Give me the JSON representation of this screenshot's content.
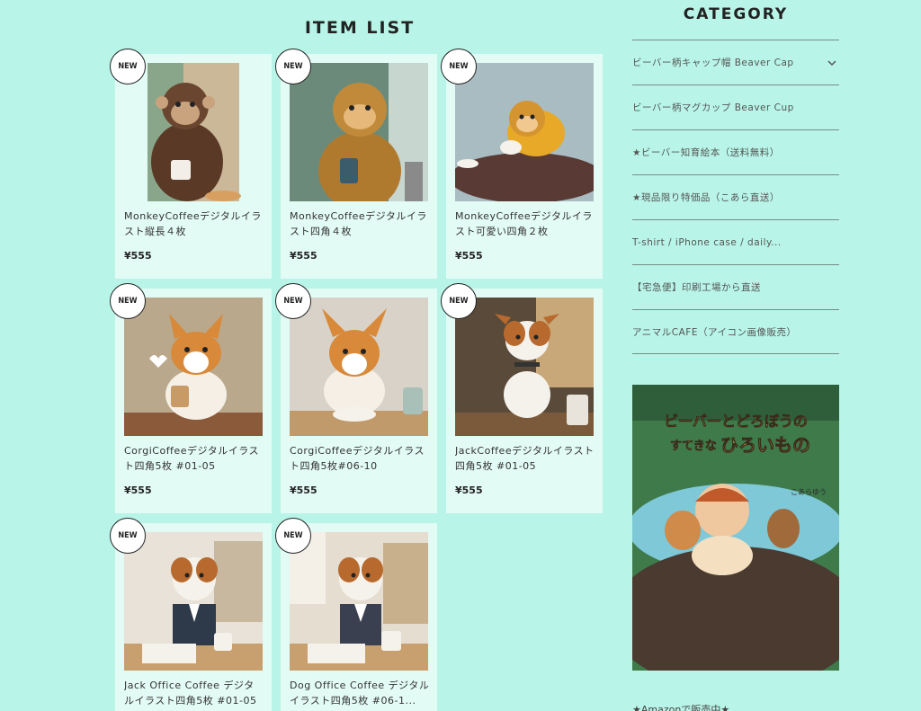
{
  "item_list_title": "ITEM LIST",
  "category_title": "CATEGORY",
  "new_badge": "NEW",
  "items": [
    {
      "name": "MonkeyCoffeeデジタルイラスト縦長４枚",
      "price": "¥555"
    },
    {
      "name": "MonkeyCoffeeデジタルイラスト四角４枚",
      "price": "¥555"
    },
    {
      "name": "MonkeyCoffeeデジタルイラスト可愛い四角２枚",
      "price": "¥555"
    },
    {
      "name": "CorgiCoffeeデジタルイラスト四角5枚 #01-05",
      "price": "¥555"
    },
    {
      "name": "CorgiCoffeeデジタルイラスト四角5枚#06-10",
      "price": "¥555"
    },
    {
      "name": "JackCoffeeデジタルイラスト四角5枚 #01-05",
      "price": "¥555"
    },
    {
      "name": "Jack Office Coffee デジタルイラスト四角5枚 #01-05",
      "price": ""
    },
    {
      "name": "Dog Office Coffee デジタルイラスト四角5枚 #06-1...",
      "price": ""
    }
  ],
  "categories": [
    "ビーバー柄キャップ帽 Beaver Cap",
    "ビーバー柄マグカップ Beaver Cup",
    "★ビーバー知育絵本（送料無料）",
    "★現品限り特価品（こあら直送）",
    "T-shirt / iPhone case / daily...",
    "【宅急便】印刷工場から直送",
    "アニマルCAFE（アイコン画像販売）"
  ],
  "book": {
    "title_line1": "ビーバーとどろぼうの",
    "title_line2": "すてきな",
    "title_line3": "ひろいもの",
    "author": "こあらゆう"
  },
  "amazon_note": "★Amazonで販売中★"
}
